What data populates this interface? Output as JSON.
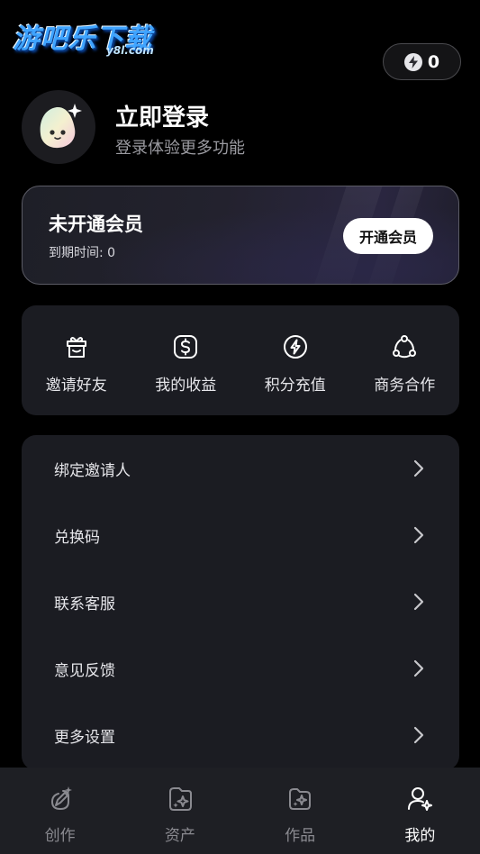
{
  "logo": {
    "main": "游吧乐下载",
    "sub": "y8l.com"
  },
  "points": {
    "icon": "lightning-icon",
    "value": "0"
  },
  "profile": {
    "title": "立即登录",
    "subtitle": "登录体验更多功能"
  },
  "vip": {
    "title": "未开通会员",
    "expire": "到期时间: 0",
    "button": "开通会员"
  },
  "quick_actions": [
    {
      "label": "邀请好友",
      "icon": "gift-icon"
    },
    {
      "label": "我的收益",
      "icon": "dollar-icon"
    },
    {
      "label": "积分充值",
      "icon": "lightning-icon"
    },
    {
      "label": "商务合作",
      "icon": "network-icon"
    }
  ],
  "menu": [
    {
      "label": "绑定邀请人"
    },
    {
      "label": "兑换码"
    },
    {
      "label": "联系客服"
    },
    {
      "label": "意见反馈"
    },
    {
      "label": "更多设置"
    }
  ],
  "tabs": [
    {
      "label": "创作",
      "icon": "create-icon",
      "active": false
    },
    {
      "label": "资产",
      "icon": "assets-icon",
      "active": false
    },
    {
      "label": "作品",
      "icon": "works-icon",
      "active": false
    },
    {
      "label": "我的",
      "icon": "profile-icon",
      "active": true
    }
  ],
  "colors": {
    "background": "#000000",
    "card": "#1b1c22",
    "tabbar": "#1e1f24",
    "logo": "#3fa4ff"
  }
}
